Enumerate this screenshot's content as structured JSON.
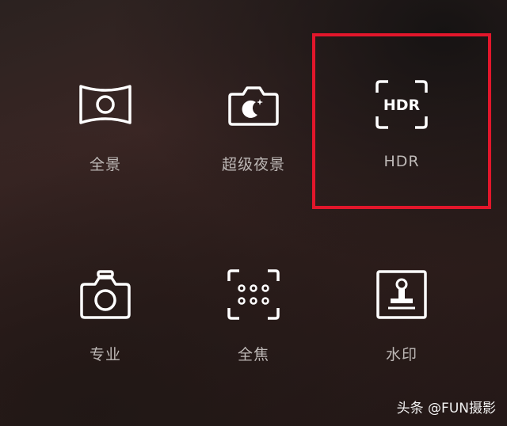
{
  "modes": [
    {
      "label": "全景",
      "icon": "panorama-icon"
    },
    {
      "label": "超级夜景",
      "icon": "night-mode-icon"
    },
    {
      "label": "HDR",
      "icon": "hdr-icon",
      "highlighted": true
    },
    {
      "label": "专业",
      "icon": "pro-camera-icon"
    },
    {
      "label": "全焦",
      "icon": "all-focus-icon"
    },
    {
      "label": "水印",
      "icon": "watermark-stamp-icon"
    }
  ],
  "hdr_icon_text": "HDR",
  "watermark": "头条 @FUN摄影",
  "colors": {
    "highlight_border": "#e2162b",
    "label": "#bdb8b6",
    "icon_stroke": "#ffffff"
  }
}
